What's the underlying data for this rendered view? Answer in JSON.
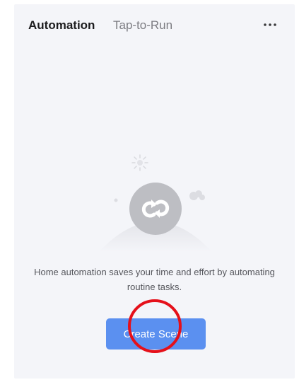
{
  "header": {
    "tabs": [
      {
        "label": "Automation",
        "active": true
      },
      {
        "label": "Tap-to-Run",
        "active": false
      }
    ],
    "more_icon": "more-horizontal-icon"
  },
  "empty_state": {
    "illustration_icon": "automation-loop-icon",
    "message": "Home automation saves your time and effort by automating routine tasks."
  },
  "actions": {
    "create_scene_label": "Create Scene"
  },
  "colors": {
    "background": "#f4f5f9",
    "primary_button": "#5b90f0",
    "annotation_circle": "#e5101a"
  }
}
